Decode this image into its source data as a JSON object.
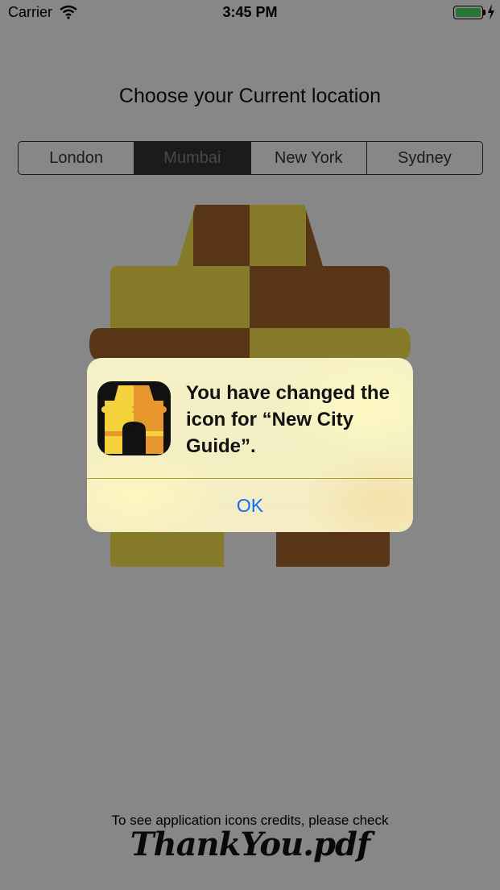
{
  "status_bar": {
    "carrier": "Carrier",
    "time": "3:45 PM"
  },
  "heading": "Choose your Current location",
  "locations": [
    "London",
    "Mumbai",
    "New York",
    "Sydney"
  ],
  "selected_location": "Mumbai",
  "credits": {
    "text": "To see application icons credits, please check",
    "link": "ThankYou.pdf"
  },
  "alert": {
    "message": "You have changed the icon for “New City Guide”.",
    "ok_label": "OK"
  },
  "icon": {
    "name": "gateway-of-india-icon",
    "colors": {
      "brown": "#a5642a",
      "olive": "#fbe74b",
      "dark": "#111111",
      "yellow": "#f3d23c",
      "orange": "#e8972f"
    }
  },
  "colors": {
    "ios_blue": "#0a6cff",
    "battery_green": "#4cd964"
  }
}
